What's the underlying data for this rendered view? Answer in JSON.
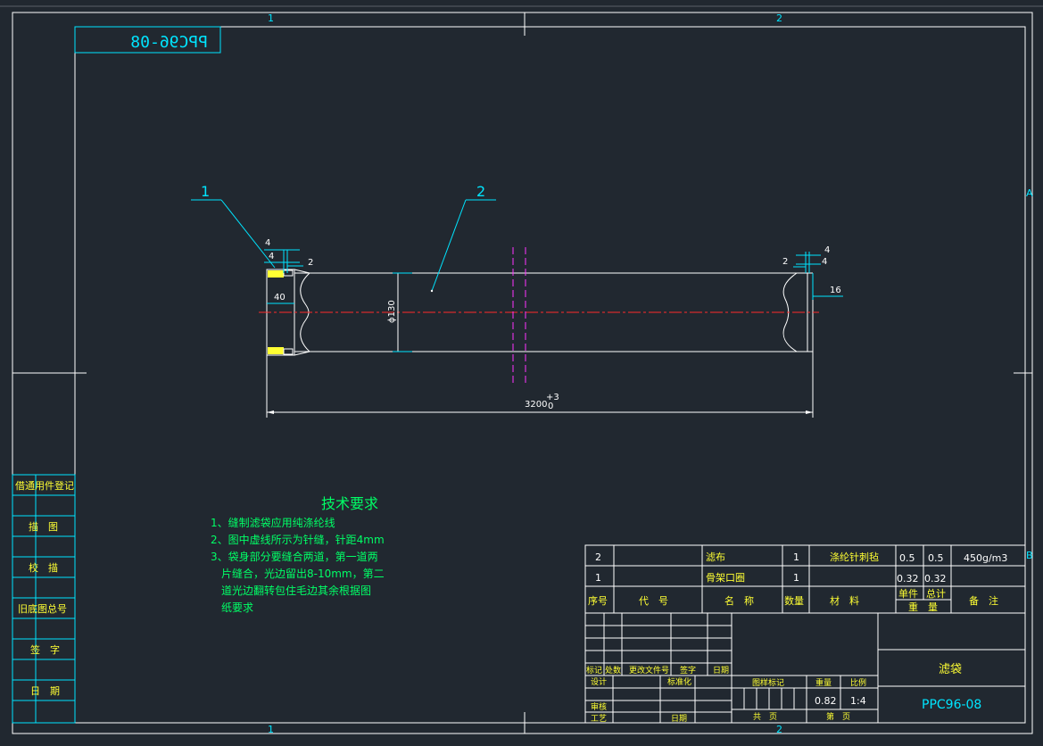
{
  "drawing": {
    "mirrored_code": "PPC96-08",
    "zones": {
      "top_1": "1",
      "top_2": "2",
      "bottom_1": "1",
      "bottom_2": "2",
      "right_a": "A",
      "right_b": "B"
    },
    "left_strip": [
      "借通用件登记",
      "描　图",
      "校　描",
      "旧底图总号",
      "签　字",
      "日　期"
    ],
    "balloons": [
      "1",
      "2"
    ],
    "dimensions": {
      "d4_a": "4",
      "d4_b": "4",
      "d2_left": "2",
      "d40": "40",
      "d2_right": "2",
      "d4_right_a": "4",
      "d4_right_b": "4",
      "d16": "16",
      "diameter": "ϕ130",
      "length": "3200",
      "length_tol_upper": "+3",
      "length_tol_lower": "0"
    },
    "tech_req": {
      "title": "技术要求",
      "lines": [
        "1、缝制滤袋应用纯涤纶线",
        "2、图中虚线所示为针缝，针距4mm",
        "3、袋身部分要缝合两道，第一道两",
        "　片缝合，光边留出8-10mm，第二",
        "　道光边翻转包住毛边其余根据图",
        "　纸要求"
      ]
    },
    "bom": {
      "rows": [
        {
          "seq": "2",
          "code": "",
          "name": "滤布",
          "qty": "1",
          "material": "涤纶针刺毡",
          "unit_w": "0.5",
          "total_w": "0.5",
          "note": "450g/m3"
        },
        {
          "seq": "1",
          "code": "",
          "name": "骨架口圈",
          "qty": "1",
          "material": "",
          "unit_w": "0.32",
          "total_w": "0.32",
          "note": ""
        }
      ],
      "headers": {
        "seq": "序号",
        "code": "代　号",
        "name": "名　称",
        "qty": "数量",
        "material": "材　料",
        "unit": "单件",
        "total": "总计",
        "weight": "重　量",
        "note": "备　注"
      }
    },
    "title_block": {
      "rev_headers": [
        "标记",
        "处数",
        "更改文件号",
        "签字",
        "日期"
      ],
      "roles": [
        "设计",
        "标准化",
        "审核",
        "工艺",
        "日期"
      ],
      "stage_mark": "图样标记",
      "weight_label": "重量",
      "scale_label": "比例",
      "weight": "0.82",
      "scale": "1:4",
      "sheets_label": "共　页",
      "sheet_label": "第　页",
      "part_name": "滤袋",
      "drawing_no": "PPC96-08"
    }
  }
}
